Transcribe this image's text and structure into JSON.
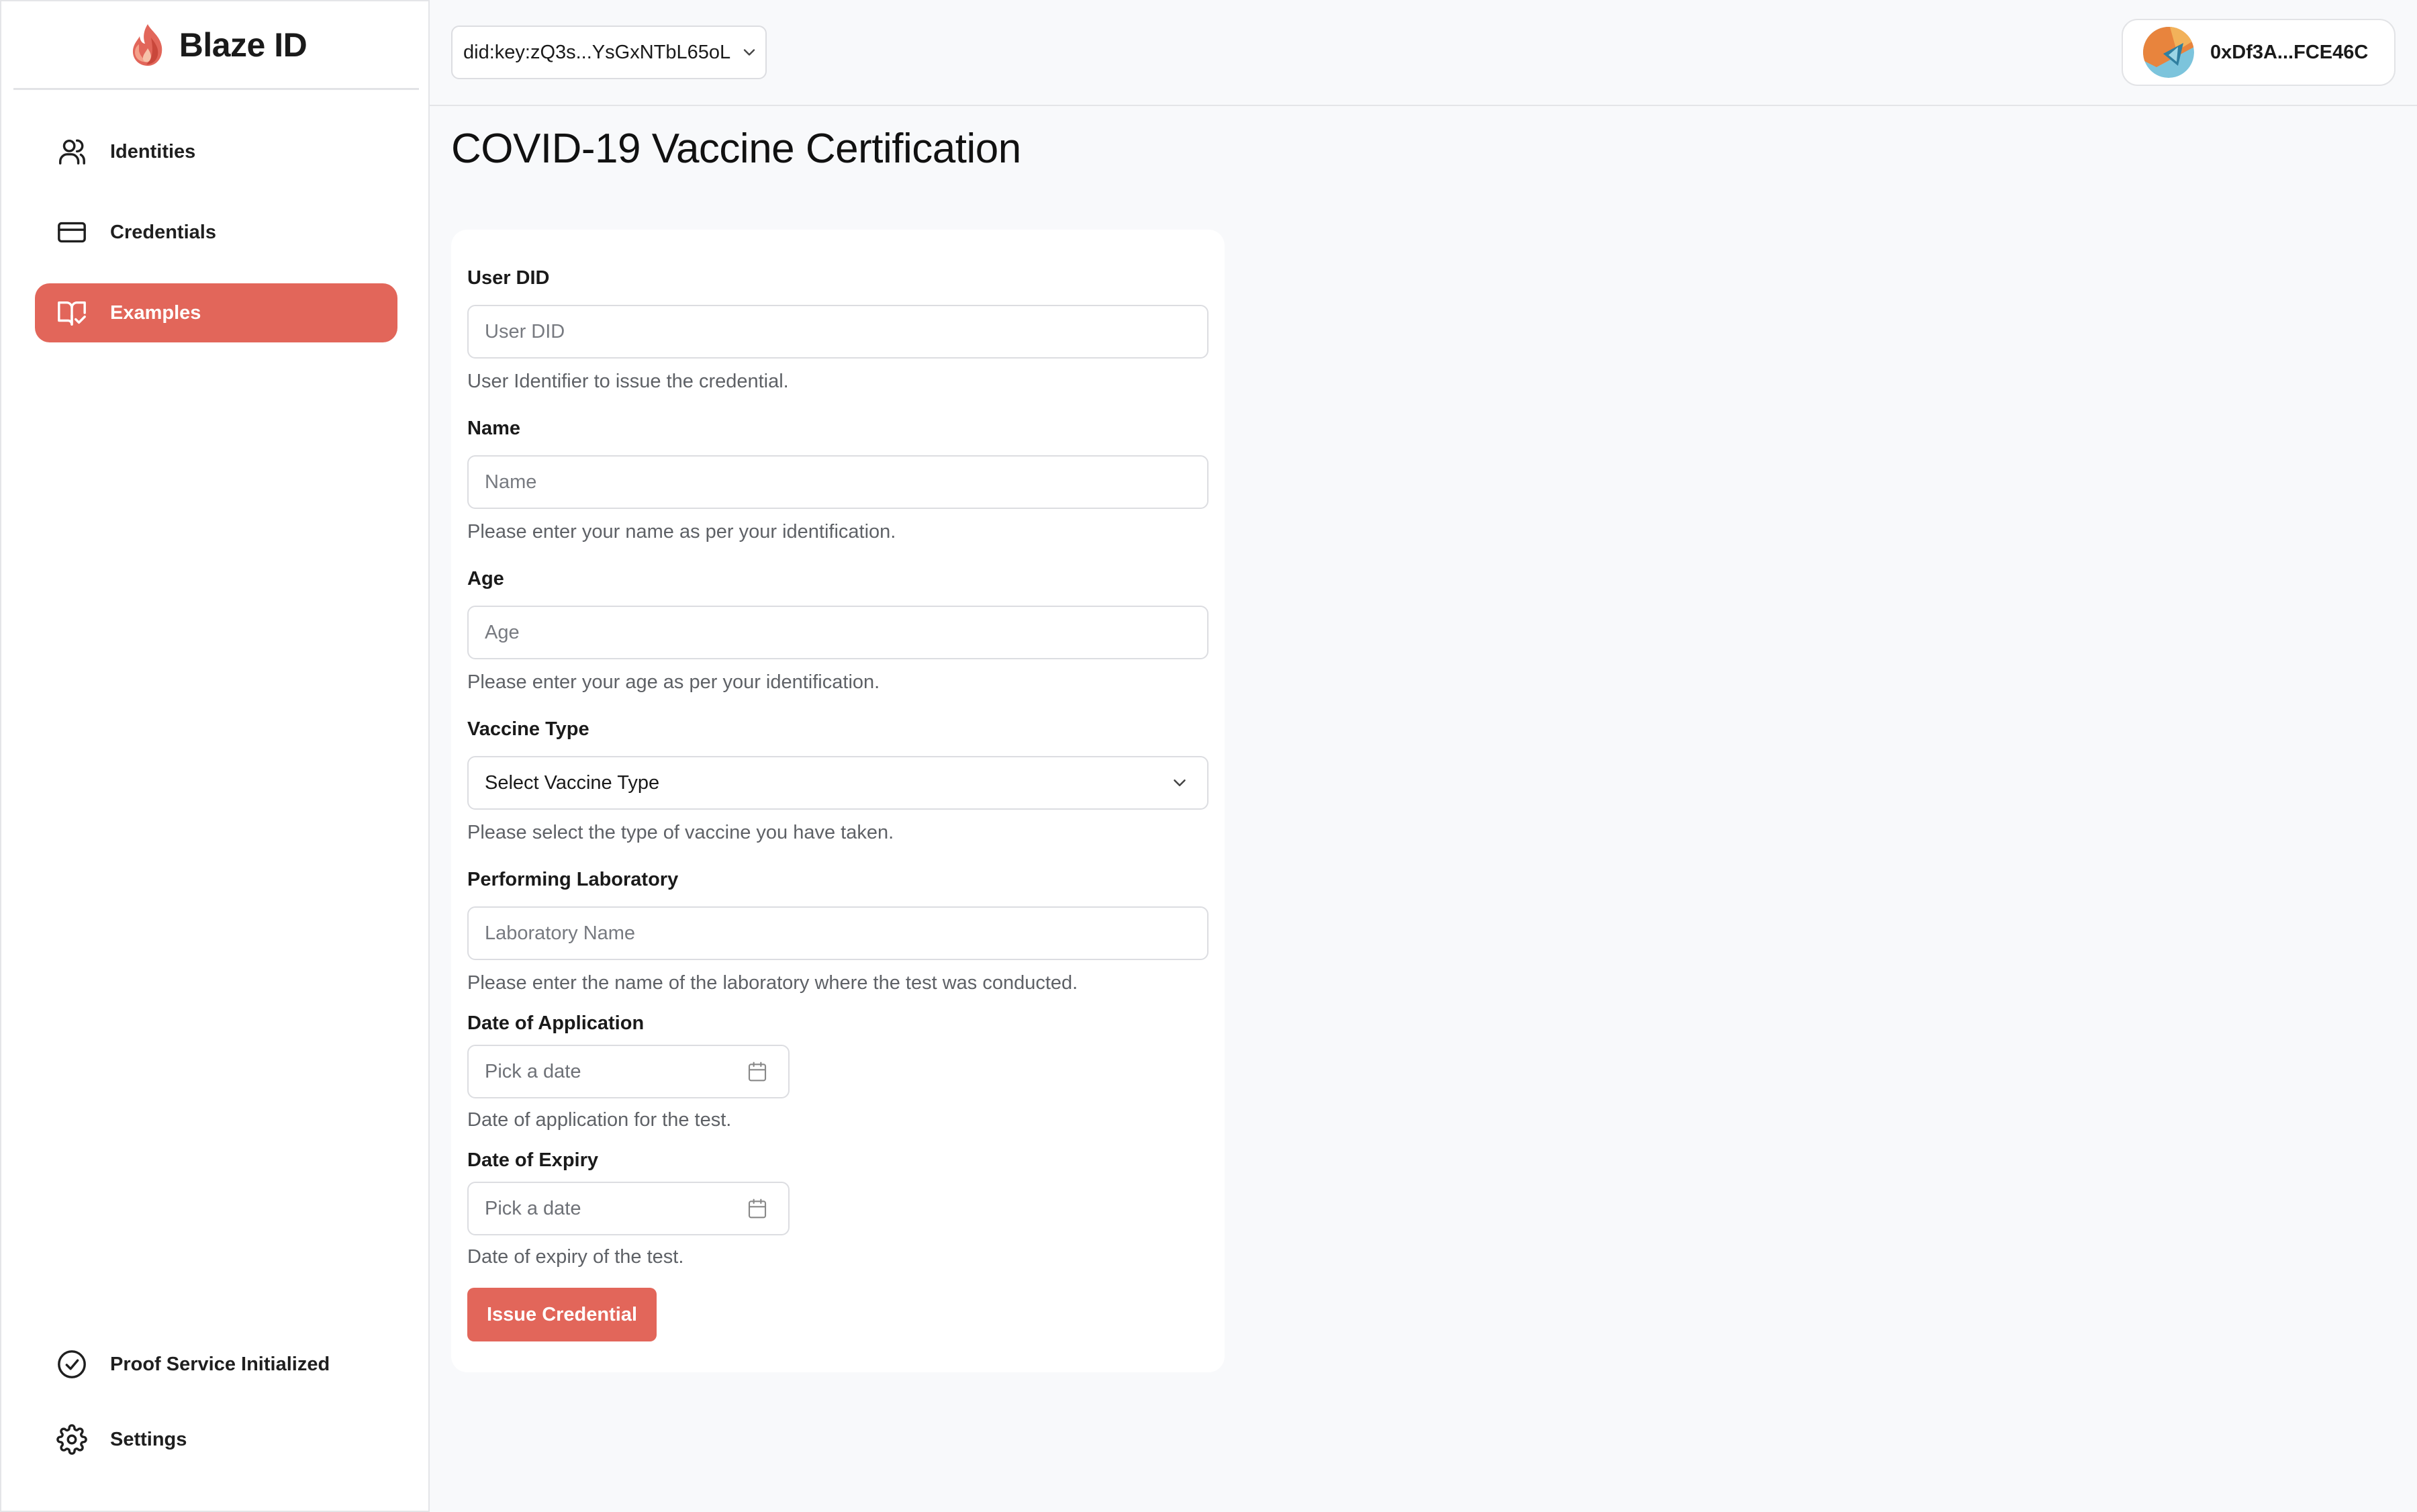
{
  "brand": {
    "name": "Blaze ID"
  },
  "sidebar": {
    "items": [
      {
        "label": "Identities",
        "icon": "users-icon"
      },
      {
        "label": "Credentials",
        "icon": "credit-card-icon"
      },
      {
        "label": "Examples",
        "icon": "book-check-icon",
        "active": true
      }
    ],
    "footer": [
      {
        "label": "Proof Service Initialized",
        "icon": "check-circle-icon"
      },
      {
        "label": "Settings",
        "icon": "gear-icon"
      }
    ]
  },
  "header": {
    "did_selector": "did:key:zQ3s...YsGxNTbL65oL",
    "wallet_address": "0xDf3A...FCE46C"
  },
  "page": {
    "title": "COVID-19 Vaccine Certification"
  },
  "form": {
    "user_did": {
      "label": "User DID",
      "placeholder": "User DID",
      "help": "User Identifier to issue the credential."
    },
    "name": {
      "label": "Name",
      "placeholder": "Name",
      "help": "Please enter your name as per your identification."
    },
    "age": {
      "label": "Age",
      "placeholder": "Age",
      "help": "Please enter your age as per your identification."
    },
    "vaccine_type": {
      "label": "Vaccine Type",
      "selected": "Select Vaccine Type",
      "help": "Please select the type of vaccine you have taken."
    },
    "laboratory": {
      "label": "Performing Laboratory",
      "placeholder": "Laboratory Name",
      "help": "Please enter the name of the laboratory where the test was conducted."
    },
    "date_application": {
      "label": "Date of Application",
      "placeholder": "Pick a date",
      "help": "Date of application for the test."
    },
    "date_expiry": {
      "label": "Date of Expiry",
      "placeholder": "Pick a date",
      "help": "Date of expiry of the test."
    },
    "submit_label": "Issue Credential"
  },
  "colors": {
    "accent": "#e2665a",
    "background": "#f8f9fb",
    "card": "#ffffff",
    "border": "#dcdde1"
  }
}
